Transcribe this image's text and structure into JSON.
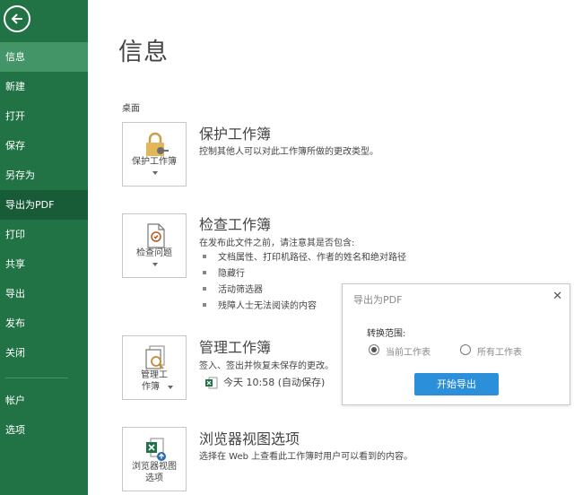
{
  "sidebar": {
    "items": [
      {
        "label": "信息"
      },
      {
        "label": "新建"
      },
      {
        "label": "打开"
      },
      {
        "label": "保存"
      },
      {
        "label": "另存为"
      },
      {
        "label": "导出为PDF"
      },
      {
        "label": "打印"
      },
      {
        "label": "共享"
      },
      {
        "label": "导出"
      },
      {
        "label": "发布"
      },
      {
        "label": "关闭"
      },
      {
        "label": "帐户"
      },
      {
        "label": "选项"
      }
    ]
  },
  "main": {
    "title": "信息",
    "location": "桌面",
    "protect": {
      "button_label": "保护工作簿",
      "title": "保护工作簿",
      "desc": "控制其他人可以对此工作簿所做的更改类型。"
    },
    "inspect": {
      "button_label": "检查问题",
      "title": "检查工作簿",
      "desc": "在发布此文件之前，请注意其是否包含:",
      "bullets": [
        "文档属性、打印机路径、作者的姓名和绝对路径",
        "隐藏行",
        "活动筛选器",
        "残障人士无法阅读的内容"
      ]
    },
    "manage": {
      "button_label_1": "管理工",
      "button_label_2": "作簿",
      "title": "管理工作簿",
      "desc": "签入、签出并恢复未保存的更改。",
      "version": "今天 10:58 (自动保存)"
    },
    "browser": {
      "button_label_1": "浏览器视图",
      "button_label_2": "选项",
      "title": "浏览器视图选项",
      "desc": "选择在 Web 上查看此工作簿时用户可以看到的内容。"
    }
  },
  "dialog": {
    "title": "导出为PDF",
    "close": "✕",
    "range_label": "转换范围:",
    "option_current": "当前工作表",
    "option_all": "所有工作表",
    "selected": "当前工作表",
    "start_button": "开始导出"
  },
  "colors": {
    "sidebar": "#217346",
    "sidebar_active": "#439467",
    "sidebar_hover": "#185c37",
    "primary_button": "#2b8fd9"
  }
}
